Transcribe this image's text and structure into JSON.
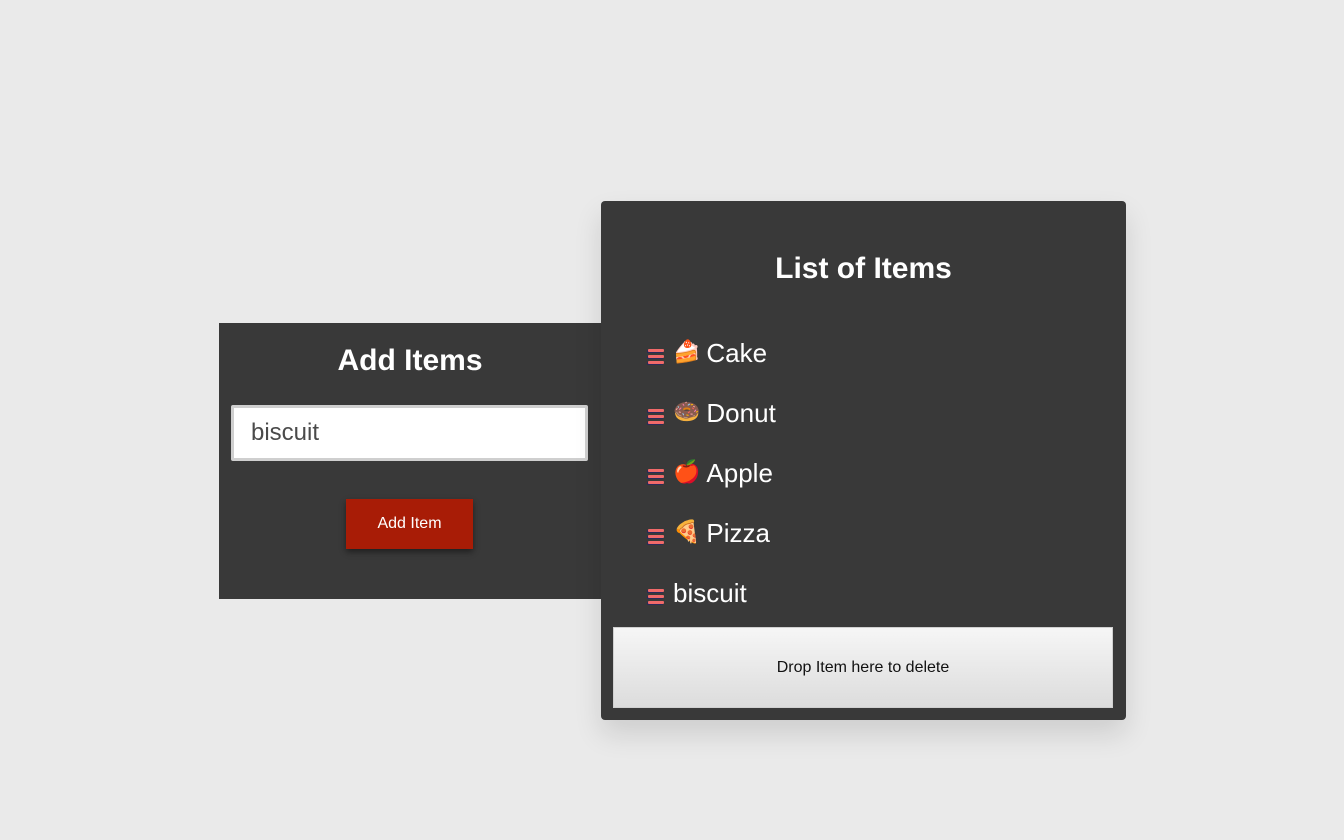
{
  "add_panel": {
    "title": "Add Items",
    "input_value": "biscuit",
    "button_label": "Add Item"
  },
  "list_panel": {
    "title": "List of Items",
    "items": [
      {
        "emoji": "🍰",
        "label": "Cake",
        "icon_name": "cake-icon"
      },
      {
        "emoji": "🍩",
        "label": "Donut",
        "icon_name": "donut-icon"
      },
      {
        "emoji": "🍎",
        "label": "Apple",
        "icon_name": "apple-icon"
      },
      {
        "emoji": "🍕",
        "label": "Pizza",
        "icon_name": "pizza-icon"
      },
      {
        "emoji": "",
        "label": "biscuit",
        "icon_name": ""
      }
    ],
    "delete_zone_label": "Drop Item here to delete"
  },
  "colors": {
    "page_background": "#eaeaea",
    "panel_background": "#393939",
    "button_background": "#a81c06",
    "handle_color": "#f06a6a"
  }
}
